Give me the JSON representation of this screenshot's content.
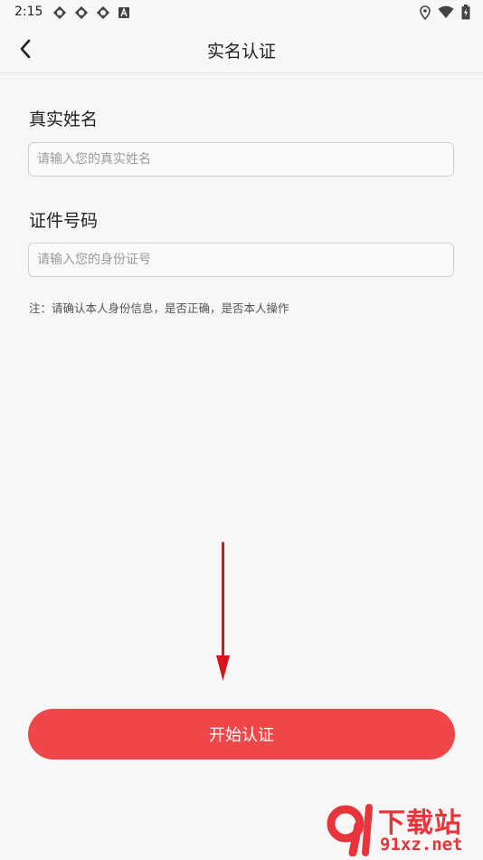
{
  "status_bar": {
    "time": "2:15",
    "left_icons": [
      "sync-icon",
      "sync-icon",
      "sync-icon",
      "app-a-icon"
    ],
    "right_icons": [
      "location-icon",
      "wifi-icon",
      "battery-icon"
    ]
  },
  "header": {
    "title": "实名认证",
    "back_icon": "chevron-left-icon"
  },
  "form": {
    "name_label": "真实姓名",
    "name_placeholder": "请输入您的真实姓名",
    "name_value": "",
    "id_label": "证件号码",
    "id_placeholder": "请输入您的身份证号",
    "id_value": "",
    "note": "注：请确认本人身份信息，是否正确，是否本人操作"
  },
  "submit": {
    "label": "开始认证"
  },
  "watermark": {
    "line1": "下载站",
    "line2": "91xz.net"
  },
  "colors": {
    "accent": "#ef464a",
    "background": "#f7f7f7",
    "annotation_arrow": "#d8151b"
  }
}
